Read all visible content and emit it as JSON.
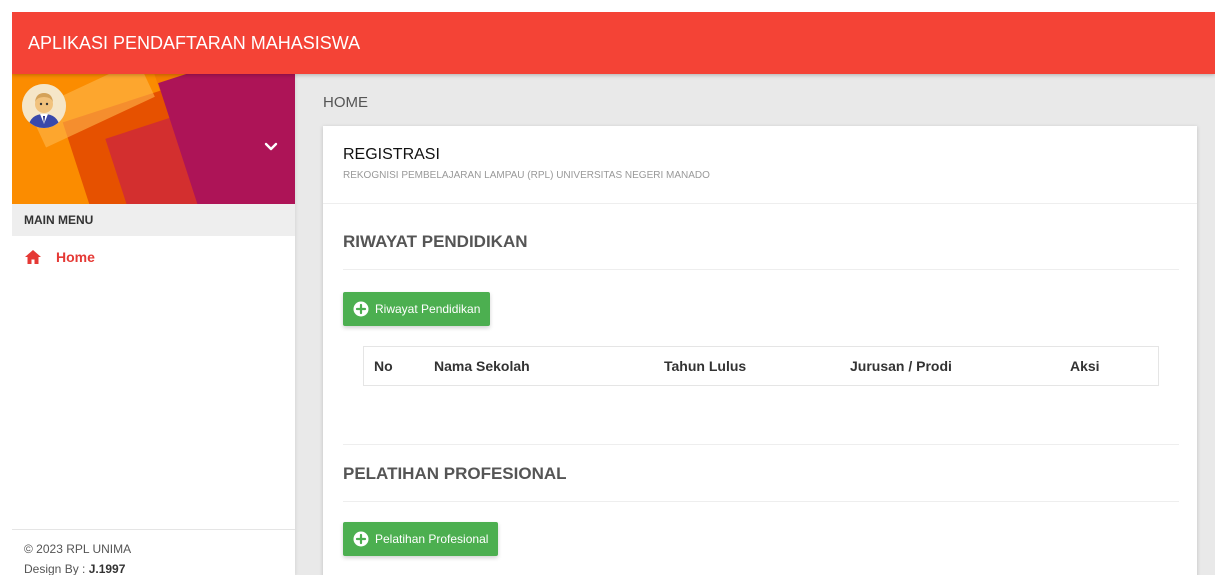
{
  "app": {
    "title": "APLIKASI PENDAFTARAN MAHASISWA"
  },
  "sidebar": {
    "menu_header": "MAIN MENU",
    "items": [
      {
        "label": "Home",
        "icon": "home-icon"
      }
    ],
    "legal": {
      "copyright": "© 2023 RPL UNIMA",
      "design_label": "Design By : ",
      "design_name": "J.1997"
    }
  },
  "page": {
    "title": "HOME"
  },
  "card": {
    "title": "REGISTRASI",
    "subtitle": "REKOGNISI PEMBELAJARAN LAMPAU (RPL) UNIVERSITAS NEGERI MANADO"
  },
  "riwayat": {
    "title": "RIWAYAT PENDIDIKAN",
    "button_label": "Riwayat Pendidikan",
    "columns": [
      "No",
      "Nama Sekolah",
      "Tahun Lulus",
      "Jurusan / Prodi",
      "Aksi"
    ]
  },
  "pelatihan": {
    "title": "PELATIHAN PROFESIONAL",
    "button_label": "Pelatihan Profesional"
  },
  "colors": {
    "primary": "#f44336",
    "success": "#4caf50",
    "menu_active": "#e53935"
  }
}
